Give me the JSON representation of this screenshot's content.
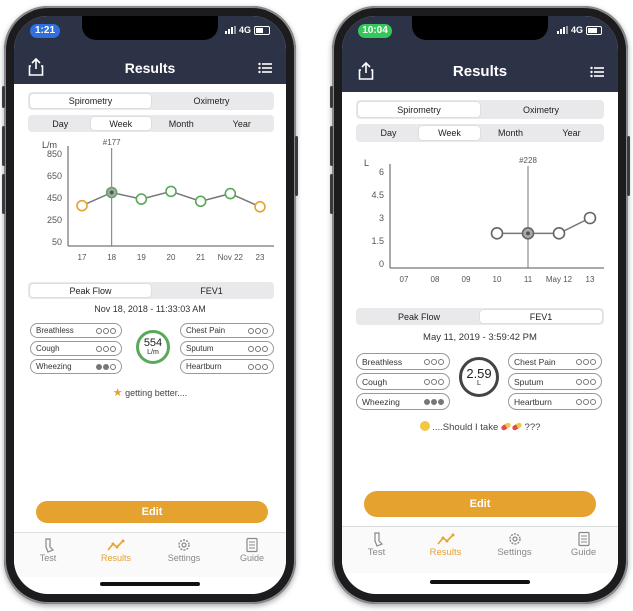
{
  "phone1": {
    "time": "1:21",
    "network": "4G",
    "title": "Results",
    "main_tabs": [
      "Spirometry",
      "Oximetry"
    ],
    "range_tabs": [
      "Day",
      "Week",
      "Month",
      "Year"
    ],
    "active_range": "Week",
    "chart_data": {
      "type": "line",
      "ylabel": "L/m",
      "y_ticks": [
        "850",
        "650",
        "450",
        "250",
        "50"
      ],
      "categories": [
        "17",
        "18",
        "19",
        "20",
        "21",
        "Nov 22",
        "23"
      ],
      "values": [
        380,
        500,
        440,
        510,
        420,
        490,
        370
      ],
      "ylim": [
        50,
        850
      ],
      "selected_label": "#177",
      "selected_index": 1,
      "point_colors": [
        "#e6a22e",
        "#5aa85a",
        "#5aa85a",
        "#5aa85a",
        "#5aa85a",
        "#5aa85a",
        "#e6a22e"
      ]
    },
    "sub_tabs": [
      "Peak Flow",
      "FEV1"
    ],
    "datetime": "Nov 18, 2018 - 11:33:03 AM",
    "left_symptoms": [
      {
        "label": "Breathless",
        "level": 0
      },
      {
        "label": "Cough",
        "level": 0
      },
      {
        "label": "Wheezing",
        "level": 2
      }
    ],
    "right_symptoms": [
      {
        "label": "Chest Pain",
        "level": 0
      },
      {
        "label": "Sputum",
        "level": 0
      },
      {
        "label": "Heartburn",
        "level": 0
      }
    ],
    "reading_value": "554",
    "reading_unit": "L/m",
    "message_icon": "star-icon",
    "message": "getting better....",
    "edit_label": "Edit",
    "bottom_tabs": [
      "Test",
      "Results",
      "Settings",
      "Guide"
    ],
    "active_tab": "Results"
  },
  "phone2": {
    "time": "10:04",
    "network": "4G",
    "title": "Results",
    "main_tabs": [
      "Spirometry",
      "Oximetry"
    ],
    "range_tabs": [
      "Day",
      "Week",
      "Month",
      "Year"
    ],
    "active_range": "Week",
    "chart_data": {
      "type": "line",
      "ylabel": "L",
      "y_ticks": [
        "6",
        "4.5",
        "3",
        "1.5",
        "0"
      ],
      "categories": [
        "07",
        "08",
        "09",
        "10",
        "11",
        "May 12",
        "13"
      ],
      "values": [
        null,
        null,
        null,
        2.0,
        2.0,
        2.0,
        3.0
      ],
      "ylim": [
        0,
        6
      ],
      "selected_label": "#228",
      "selected_index": 4,
      "point_colors": [
        "#666",
        "#666",
        "#666",
        "#666",
        "#666",
        "#666",
        "#666"
      ]
    },
    "sub_tabs": [
      "Peak Flow",
      "FEV1"
    ],
    "datetime": "May 11, 2019 - 3:59:42 PM",
    "left_symptoms": [
      {
        "label": "Breathless",
        "level": 0
      },
      {
        "label": "Cough",
        "level": 0
      },
      {
        "label": "Wheezing",
        "level": 3
      }
    ],
    "right_symptoms": [
      {
        "label": "Chest Pain",
        "level": 0
      },
      {
        "label": "Sputum",
        "level": 0
      },
      {
        "label": "Heartburn",
        "level": 0
      }
    ],
    "reading_value": "2.59",
    "reading_unit": "L",
    "message_icon": "thinking-face-icon",
    "message_prefix": "....Should I take",
    "message_suffix": "???",
    "pill_icon": "pill-icon",
    "edit_label": "Edit",
    "bottom_tabs": [
      "Test",
      "Results",
      "Settings",
      "Guide"
    ],
    "active_tab": "Results"
  },
  "colors": {
    "navy": "#2c3346",
    "accent": "#e6a22e",
    "good": "#5aa85a",
    "time_pill_1": "#2f6fe0",
    "time_pill_2": "#34c759"
  }
}
